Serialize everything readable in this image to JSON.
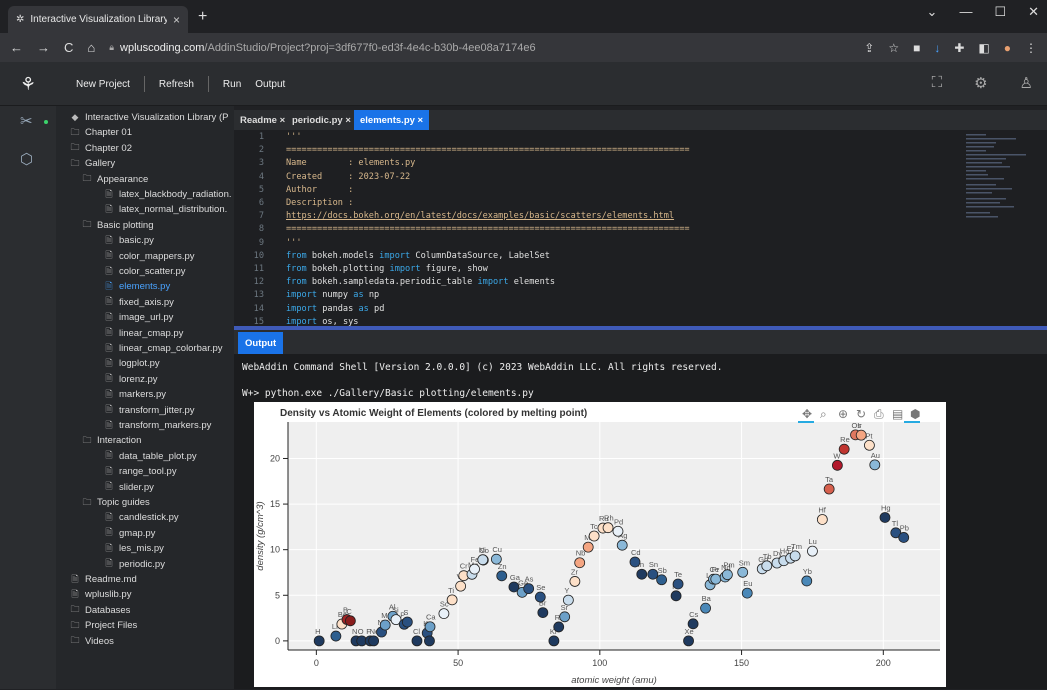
{
  "browser": {
    "tab_title": "Interactive Visualization Library (I",
    "tab_close": "×",
    "new_tab": "+",
    "url_domain": "wpluscoding.com",
    "url_path": "/AddinStudio/Project?proj=3df677f0-ed3f-4e4c-b30b-4ee08a7174e6"
  },
  "toolbar": {
    "new_project": "New Project",
    "refresh": "Refresh",
    "run": "Run",
    "output": "Output"
  },
  "tree": [
    {
      "label": "Interactive Visualization Library (P",
      "icon": "project-icon",
      "level": 0
    },
    {
      "label": "Chapter 01",
      "icon": "folder-icon",
      "level": 1
    },
    {
      "label": "Chapter 02",
      "icon": "folder-icon",
      "level": 1
    },
    {
      "label": "Gallery",
      "icon": "folder-icon",
      "level": 1
    },
    {
      "label": "Appearance",
      "icon": "folder-icon",
      "level": 2
    },
    {
      "label": "latex_blackbody_radiation.",
      "icon": "file-icon",
      "level": 3
    },
    {
      "label": "latex_normal_distribution.",
      "icon": "file-icon",
      "level": 3
    },
    {
      "label": "Basic plotting",
      "icon": "folder-icon",
      "level": 2
    },
    {
      "label": "basic.py",
      "icon": "file-icon",
      "level": 3
    },
    {
      "label": "color_mappers.py",
      "icon": "file-icon",
      "level": 3
    },
    {
      "label": "color_scatter.py",
      "icon": "file-icon",
      "level": 3
    },
    {
      "label": "elements.py",
      "icon": "file-icon",
      "level": 3,
      "active": true
    },
    {
      "label": "fixed_axis.py",
      "icon": "file-icon",
      "level": 3
    },
    {
      "label": "image_url.py",
      "icon": "file-icon",
      "level": 3
    },
    {
      "label": "linear_cmap.py",
      "icon": "file-icon",
      "level": 3
    },
    {
      "label": "linear_cmap_colorbar.py",
      "icon": "file-icon",
      "level": 3
    },
    {
      "label": "logplot.py",
      "icon": "file-icon",
      "level": 3
    },
    {
      "label": "lorenz.py",
      "icon": "file-icon",
      "level": 3
    },
    {
      "label": "markers.py",
      "icon": "file-icon",
      "level": 3
    },
    {
      "label": "transform_jitter.py",
      "icon": "file-icon",
      "level": 3
    },
    {
      "label": "transform_markers.py",
      "icon": "file-icon",
      "level": 3
    },
    {
      "label": "Interaction",
      "icon": "folder-icon",
      "level": 2
    },
    {
      "label": "data_table_plot.py",
      "icon": "file-icon",
      "level": 3
    },
    {
      "label": "range_tool.py",
      "icon": "file-icon",
      "level": 3
    },
    {
      "label": "slider.py",
      "icon": "file-icon",
      "level": 3
    },
    {
      "label": "Topic guides",
      "icon": "folder-icon",
      "level": 2
    },
    {
      "label": "candlestick.py",
      "icon": "file-icon",
      "level": 3
    },
    {
      "label": "gmap.py",
      "icon": "file-icon",
      "level": 3
    },
    {
      "label": "les_mis.py",
      "icon": "file-icon",
      "level": 3
    },
    {
      "label": "periodic.py",
      "icon": "file-icon",
      "level": 3
    },
    {
      "label": "Readme.md",
      "icon": "file-icon",
      "level": 1
    },
    {
      "label": "wpluslib.py",
      "icon": "file-icon",
      "level": 1
    },
    {
      "label": "Databases",
      "icon": "folder-icon",
      "level": 0
    },
    {
      "label": "Project Files",
      "icon": "folder-icon",
      "level": 0
    },
    {
      "label": "Videos",
      "icon": "folder-icon",
      "level": 0
    }
  ],
  "editor_tabs": [
    {
      "label": "Readme ×",
      "active": false
    },
    {
      "label": "periodic.py ×",
      "active": false
    },
    {
      "label": "elements.py ×",
      "active": true
    }
  ],
  "code": [
    {
      "n": "1",
      "t": "'''",
      "k": "tx"
    },
    {
      "n": "2",
      "t": "==============================================================================",
      "k": "tx"
    },
    {
      "n": "3",
      "t": "Name        : elements.py",
      "k": "tx"
    },
    {
      "n": "4",
      "t": "Created     : 2023-07-22",
      "k": "tx"
    },
    {
      "n": "5",
      "t": "Author      :",
      "k": "tx"
    },
    {
      "n": "6",
      "t": "Description :",
      "k": "tx"
    },
    {
      "n": "7",
      "t": "https://docs.bokeh.org/en/latest/docs/examples/basic/scatters/elements.html",
      "k": "tx"
    },
    {
      "n": "8",
      "t": "==============================================================================",
      "k": "tx"
    },
    {
      "n": "9",
      "t": "'''",
      "k": "tx"
    },
    {
      "n": "10",
      "t": "from bokeh.models import ColumnDataSource, LabelSet",
      "k": "py"
    },
    {
      "n": "11",
      "t": "from bokeh.plotting import figure, show",
      "k": "py"
    },
    {
      "n": "12",
      "t": "from bokeh.sampledata.periodic_table import elements",
      "k": "py"
    },
    {
      "n": "13",
      "t": "import numpy as np",
      "k": "py"
    },
    {
      "n": "14",
      "t": "import pandas as pd",
      "k": "py"
    },
    {
      "n": "15",
      "t": "import os, sys",
      "k": "py"
    }
  ],
  "output": {
    "tab": "Output",
    "line1": "WebAddin Command Shell [Version 2.0.0.0] (c) 2023 WebAddin LLC. All rights reserved.",
    "line2": "W+> python.exe ./Gallery/Basic plotting/elements.py"
  },
  "chart_data": {
    "type": "scatter",
    "title": "Density vs Atomic Weight of Elements (colored by melting point)",
    "xlabel": "atomic weight (amu)",
    "ylabel": "density (g/cm^3)",
    "xlim": [
      -10,
      220
    ],
    "ylim": [
      -1,
      24
    ],
    "xticks": [
      0,
      50,
      100,
      150,
      200
    ],
    "yticks": [
      0,
      5,
      10,
      15,
      20
    ],
    "grid": true,
    "points": [
      {
        "s": "H",
        "x": 1.0,
        "y": 0.0,
        "c": "#1f3a5f"
      },
      {
        "s": "Li",
        "x": 6.9,
        "y": 0.53,
        "c": "#2e5f8f"
      },
      {
        "s": "Be",
        "x": 9.0,
        "y": 1.85,
        "c": "#fde0c8"
      },
      {
        "s": "B",
        "x": 10.8,
        "y": 2.34,
        "c": "#a02424"
      },
      {
        "s": "C",
        "x": 12.0,
        "y": 2.2,
        "c": "#8a1e1e"
      },
      {
        "s": "N",
        "x": 14.0,
        "y": 0.0,
        "c": "#1f3a5f"
      },
      {
        "s": "O",
        "x": 16.0,
        "y": 0.0,
        "c": "#1f3a5f"
      },
      {
        "s": "F",
        "x": 19.0,
        "y": 0.0,
        "c": "#1f3a5f"
      },
      {
        "s": "Ne",
        "x": 20.2,
        "y": 0.0,
        "c": "#1f3a5f"
      },
      {
        "s": "Na",
        "x": 23.0,
        "y": 0.97,
        "c": "#2a5080"
      },
      {
        "s": "Mg",
        "x": 24.3,
        "y": 1.74,
        "c": "#6ca0c8"
      },
      {
        "s": "Al",
        "x": 27.0,
        "y": 2.7,
        "c": "#6ca0c8"
      },
      {
        "s": "Si",
        "x": 28.1,
        "y": 2.33,
        "c": "#e8f0f8"
      },
      {
        "s": "P",
        "x": 31.0,
        "y": 1.82,
        "c": "#2a5080"
      },
      {
        "s": "S",
        "x": 32.1,
        "y": 2.07,
        "c": "#2a5080"
      },
      {
        "s": "Cl",
        "x": 35.5,
        "y": 0.0,
        "c": "#1f3a5f"
      },
      {
        "s": "K",
        "x": 39.1,
        "y": 0.86,
        "c": "#2a5080"
      },
      {
        "s": "Ar",
        "x": 39.9,
        "y": 0.0,
        "c": "#1f3a5f"
      },
      {
        "s": "Ca",
        "x": 40.1,
        "y": 1.55,
        "c": "#6ca0c8"
      },
      {
        "s": "Sc",
        "x": 45.0,
        "y": 2.99,
        "c": "#e8f0f8"
      },
      {
        "s": "Ti",
        "x": 47.9,
        "y": 4.5,
        "c": "#fde0c8"
      },
      {
        "s": "V",
        "x": 50.9,
        "y": 6.0,
        "c": "#fde0c8"
      },
      {
        "s": "Cr",
        "x": 52.0,
        "y": 7.15,
        "c": "#fde0c8"
      },
      {
        "s": "Mn",
        "x": 54.9,
        "y": 7.3,
        "c": "#c8dcec"
      },
      {
        "s": "Fe",
        "x": 55.8,
        "y": 7.87,
        "c": "#e8f0f8"
      },
      {
        "s": "Co",
        "x": 58.9,
        "y": 8.86,
        "c": "#e8f0f8"
      },
      {
        "s": "Ni",
        "x": 58.7,
        "y": 8.9,
        "c": "#c8dcec"
      },
      {
        "s": "Cu",
        "x": 63.5,
        "y": 8.96,
        "c": "#8ab8d8"
      },
      {
        "s": "Zn",
        "x": 65.4,
        "y": 7.13,
        "c": "#2e5f8f"
      },
      {
        "s": "Ga",
        "x": 69.7,
        "y": 5.91,
        "c": "#1f3a5f"
      },
      {
        "s": "Ge",
        "x": 72.6,
        "y": 5.32,
        "c": "#6ca0c8"
      },
      {
        "s": "As",
        "x": 74.9,
        "y": 5.73,
        "c": "#2a5080"
      },
      {
        "s": "Se",
        "x": 79.0,
        "y": 4.81,
        "c": "#2a5080"
      },
      {
        "s": "Br",
        "x": 79.9,
        "y": 3.1,
        "c": "#1f3a5f"
      },
      {
        "s": "Kr",
        "x": 83.8,
        "y": 0.0,
        "c": "#1f3a5f"
      },
      {
        "s": "Rb",
        "x": 85.5,
        "y": 1.53,
        "c": "#1f3a5f"
      },
      {
        "s": "Sr",
        "x": 87.6,
        "y": 2.64,
        "c": "#6ca0c8"
      },
      {
        "s": "Y",
        "x": 88.9,
        "y": 4.47,
        "c": "#c8dcec"
      },
      {
        "s": "Zr",
        "x": 91.2,
        "y": 6.52,
        "c": "#fde0c8"
      },
      {
        "s": "Nb",
        "x": 92.9,
        "y": 8.57,
        "c": "#f4a582"
      },
      {
        "s": "Mo",
        "x": 95.9,
        "y": 10.28,
        "c": "#f4a582"
      },
      {
        "s": "Tc",
        "x": 98.0,
        "y": 11.5,
        "c": "#fde0c8"
      },
      {
        "s": "Ru",
        "x": 101.1,
        "y": 12.37,
        "c": "#fde0c8"
      },
      {
        "s": "Rh",
        "x": 102.9,
        "y": 12.41,
        "c": "#fde0c8"
      },
      {
        "s": "Pd",
        "x": 106.4,
        "y": 12.02,
        "c": "#e8f0f8"
      },
      {
        "s": "Ag",
        "x": 107.9,
        "y": 10.49,
        "c": "#8ab8d8"
      },
      {
        "s": "Cd",
        "x": 112.4,
        "y": 8.65,
        "c": "#2a5080"
      },
      {
        "s": "In",
        "x": 114.8,
        "y": 7.31,
        "c": "#1f3a5f"
      },
      {
        "s": "Sn",
        "x": 118.7,
        "y": 7.31,
        "c": "#2a5080"
      },
      {
        "s": "Sb",
        "x": 121.8,
        "y": 6.7,
        "c": "#2e5f8f"
      },
      {
        "s": "Te",
        "x": 127.6,
        "y": 6.24,
        "c": "#2a5080"
      },
      {
        "s": "I",
        "x": 126.9,
        "y": 4.94,
        "c": "#1f3a5f"
      },
      {
        "s": "Xe",
        "x": 131.3,
        "y": 0.0,
        "c": "#1f3a5f"
      },
      {
        "s": "Cs",
        "x": 132.9,
        "y": 1.87,
        "c": "#1f3a5f"
      },
      {
        "s": "Ba",
        "x": 137.3,
        "y": 3.59,
        "c": "#4a88b8"
      },
      {
        "s": "La",
        "x": 138.9,
        "y": 6.15,
        "c": "#8ab8d8"
      },
      {
        "s": "Ce",
        "x": 140.1,
        "y": 6.77,
        "c": "#8ab8d8"
      },
      {
        "s": "Pr",
        "x": 140.9,
        "y": 6.77,
        "c": "#8ab8d8"
      },
      {
        "s": "Nd",
        "x": 144.2,
        "y": 7.01,
        "c": "#8ab8d8"
      },
      {
        "s": "Pm",
        "x": 145.0,
        "y": 7.26,
        "c": "#8ab8d8"
      },
      {
        "s": "Sm",
        "x": 150.4,
        "y": 7.52,
        "c": "#8ab8d8"
      },
      {
        "s": "Eu",
        "x": 152.0,
        "y": 5.24,
        "c": "#4a88b8"
      },
      {
        "s": "Gd",
        "x": 157.3,
        "y": 7.9,
        "c": "#c8dcec"
      },
      {
        "s": "Tb",
        "x": 158.9,
        "y": 8.23,
        "c": "#c8dcec"
      },
      {
        "s": "Dy",
        "x": 162.5,
        "y": 8.54,
        "c": "#c8dcec"
      },
      {
        "s": "Ho",
        "x": 164.9,
        "y": 8.79,
        "c": "#c8dcec"
      },
      {
        "s": "Er",
        "x": 167.3,
        "y": 9.07,
        "c": "#c8dcec"
      },
      {
        "s": "Tm",
        "x": 168.9,
        "y": 9.32,
        "c": "#c8dcec"
      },
      {
        "s": "Yb",
        "x": 173.0,
        "y": 6.57,
        "c": "#4a88b8"
      },
      {
        "s": "Lu",
        "x": 175.0,
        "y": 9.84,
        "c": "#e8f0f8"
      },
      {
        "s": "Hf",
        "x": 178.5,
        "y": 13.31,
        "c": "#fde0c8"
      },
      {
        "s": "Ta",
        "x": 180.9,
        "y": 16.65,
        "c": "#d6604d"
      },
      {
        "s": "W",
        "x": 183.8,
        "y": 19.25,
        "c": "#b2182b"
      },
      {
        "s": "Re",
        "x": 186.2,
        "y": 21.02,
        "c": "#c03530"
      },
      {
        "s": "Os",
        "x": 190.2,
        "y": 22.59,
        "c": "#e07860"
      },
      {
        "s": "Ir",
        "x": 192.2,
        "y": 22.56,
        "c": "#f4a582"
      },
      {
        "s": "Pt",
        "x": 195.1,
        "y": 21.45,
        "c": "#fde0c8"
      },
      {
        "s": "Au",
        "x": 197.0,
        "y": 19.3,
        "c": "#8ab8d8"
      },
      {
        "s": "Hg",
        "x": 200.6,
        "y": 13.53,
        "c": "#1f3a5f"
      },
      {
        "s": "Tl",
        "x": 204.4,
        "y": 11.85,
        "c": "#2a5080"
      },
      {
        "s": "Pb",
        "x": 207.2,
        "y": 11.34,
        "c": "#2a5080"
      }
    ]
  }
}
